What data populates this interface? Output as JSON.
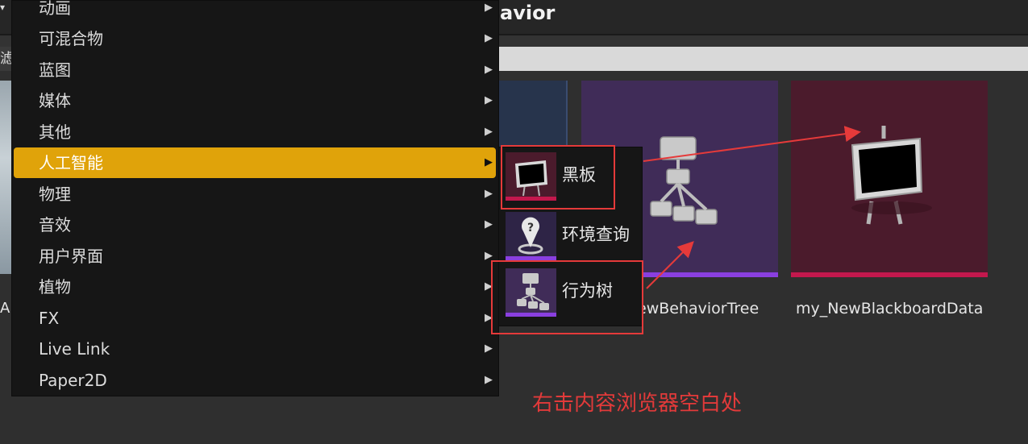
{
  "window": {
    "title_fragment": "avior",
    "filter_label_fragment": "滤器"
  },
  "menu": {
    "items": [
      {
        "label": "动画",
        "active": false
      },
      {
        "label": "可混合物",
        "active": false
      },
      {
        "label": "蓝图",
        "active": false
      },
      {
        "label": "媒体",
        "active": false
      },
      {
        "label": "其他",
        "active": false
      },
      {
        "label": "人工智能",
        "active": true
      },
      {
        "label": "物理",
        "active": false
      },
      {
        "label": "音效",
        "active": false
      },
      {
        "label": "用户界面",
        "active": false
      },
      {
        "label": "植物",
        "active": false
      },
      {
        "label": "FX",
        "active": false
      },
      {
        "label": "Live Link",
        "active": false
      },
      {
        "label": "Paper2D",
        "active": false
      }
    ]
  },
  "submenu": {
    "items": [
      {
        "label": "黑板",
        "icon": "blackboard-icon",
        "accent": "#c3184d"
      },
      {
        "label": "环境查询",
        "icon": "env-query-icon",
        "accent": "#8a3fe0"
      },
      {
        "label": "行为树",
        "icon": "behavior-tree-icon",
        "accent": "#8a3fe0"
      }
    ]
  },
  "assets": {
    "left_label_fragment": "A",
    "behavior_tree_label": "ewBehaviorTree",
    "blackboard_label": "my_NewBlackboardData"
  },
  "annotation": {
    "text": "右击内容浏览器空白处",
    "color": "#e23a3a"
  },
  "colors": {
    "menu_active": "#e0a30a",
    "menu_bg": "#161616",
    "page_bg": "#2f2f2f"
  }
}
